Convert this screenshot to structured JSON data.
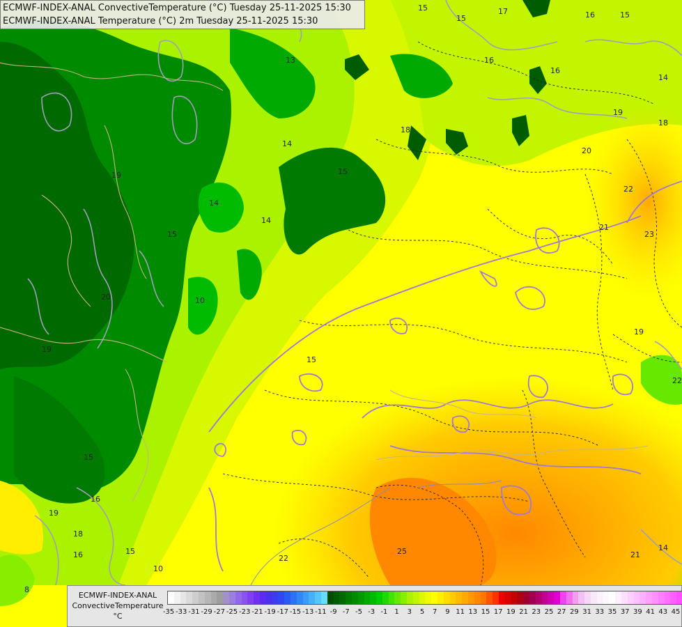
{
  "header": {
    "line1": "ECMWF-INDEX-ANAL ConvectiveTemperature (°C) Tuesday 25-11-2025 15:30",
    "line2": "ECMWF-INDEX-ANAL Temperature (°C) 2m Tuesday 25-11-2025 15:30"
  },
  "legend": {
    "title_line1": "ECMWF-INDEX-ANAL",
    "title_line2": "ConvectiveTemperature",
    "unit": "°C",
    "ticks": [
      "-35",
      "-33",
      "-31",
      "-29",
      "-27",
      "-25",
      "-23",
      "-21",
      "-19",
      "-17",
      "-15",
      "-13",
      "-11",
      "-9",
      "-7",
      "-5",
      "-3",
      "-1",
      "1",
      "3",
      "5",
      "7",
      "9",
      "11",
      "13",
      "15",
      "17",
      "19",
      "21",
      "23",
      "25",
      "27",
      "29",
      "31",
      "33",
      "35",
      "37",
      "39",
      "41",
      "43",
      "45"
    ],
    "colors": [
      "#ffffff",
      "#f2f2f2",
      "#e6e6e6",
      "#dadada",
      "#cecece",
      "#c2c2c2",
      "#b6b6b6",
      "#aaaaaa",
      "#9e9e9e",
      "#a290c8",
      "#9a7ee0",
      "#9168e8",
      "#8a55ee",
      "#8040f0",
      "#7030f2",
      "#5a2cf2",
      "#4a30f0",
      "#3c3cf2",
      "#2f47f5",
      "#2a5cf5",
      "#2c72f5",
      "#2f88f5",
      "#3a9cf6",
      "#48b0f7",
      "#56c6f8",
      "#66dcf8",
      "#004d00",
      "#005c00",
      "#006a00",
      "#007a00",
      "#008a00",
      "#009a00",
      "#00aa00",
      "#00bb00",
      "#00cc00",
      "#22d800",
      "#44e200",
      "#66e800",
      "#88ee00",
      "#aaf200",
      "#c4f500",
      "#dcf800",
      "#eefc00",
      "#ffff00",
      "#ffee00",
      "#ffdd00",
      "#ffcc00",
      "#ffbb00",
      "#ffaa00",
      "#ff9900",
      "#ff8800",
      "#ff7700",
      "#ff5500",
      "#ff3300",
      "#ee0000",
      "#d80000",
      "#c40000",
      "#b00010",
      "#a00030",
      "#a00050",
      "#b00070",
      "#c00090",
      "#d000b0",
      "#e000d0",
      "#ee44ee",
      "#f070f0",
      "#f29cf2",
      "#f4c0f4",
      "#f6d8f6",
      "#f8e8f8",
      "#fbf2fb",
      "#fdf8fd",
      "#ffffff",
      "#fff0ff",
      "#ffe0ff",
      "#ffd0ff",
      "#ffc0ff",
      "#ffb0ff",
      "#ffa0ff",
      "#ff90ff",
      "#ff80ff",
      "#ff70ff",
      "#ff60ff",
      "#ff50ff"
    ]
  },
  "map": {
    "contour_labels": [
      "13",
      "15",
      "17",
      "16",
      "16",
      "15",
      "14",
      "15",
      "18",
      "19",
      "14",
      "18",
      "16",
      "20",
      "22",
      "23",
      "21",
      "14",
      "19",
      "22",
      "19",
      "20",
      "15",
      "16",
      "19",
      "18",
      "10",
      "10",
      "25",
      "15",
      "22",
      "14",
      "15",
      "19",
      "16",
      "15",
      "8",
      "21",
      "14",
      "15"
    ]
  }
}
